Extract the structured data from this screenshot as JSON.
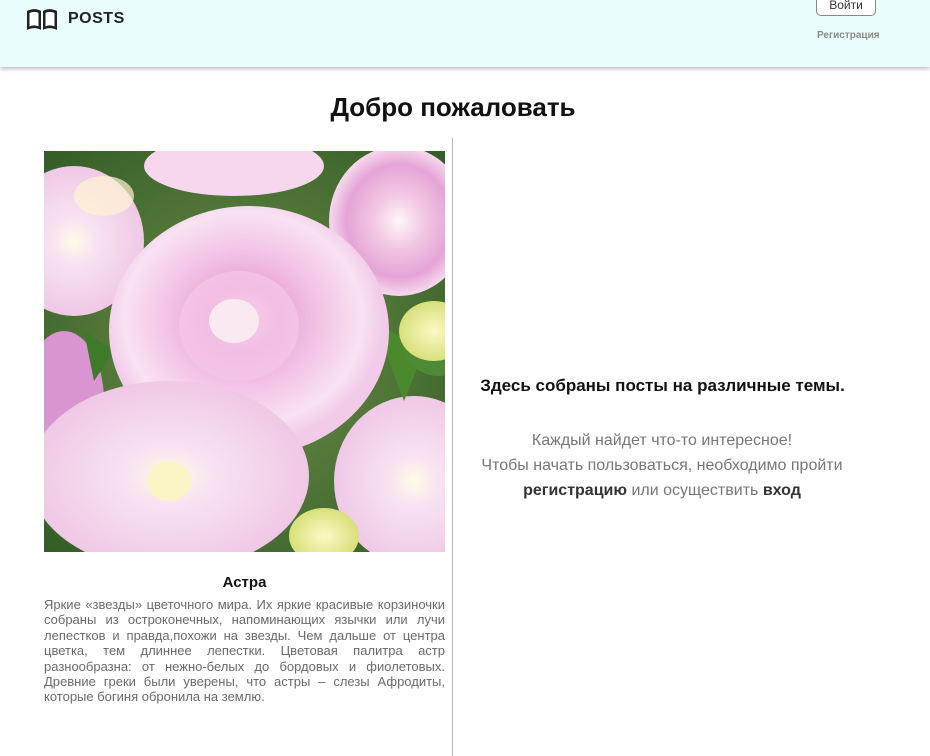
{
  "header": {
    "brand": "POSTS",
    "logo_icon": "book-icon",
    "login_label": "Войти",
    "register_label": "Регистрация",
    "background": "#eafdfd"
  },
  "main": {
    "title": "Добро пожаловать"
  },
  "card": {
    "image_subject": "pink aster flowers",
    "title": "Астра",
    "description": "Яркие «звезды» цветочного мира. Их яркие красивые корзиночки собраны из остроконечных, напоминающих язычки или лучи лепестков и правда,похожи на звезды. Чем дальше от центра цветка, тем длиннее лепестки. Цветовая палитра астр разнообразна: от нежно-белых до бордовых и фиолетовых. Древние греки были уверены, что астры – слезы Афродиты, которые богиня обронила на землю."
  },
  "intro": {
    "heading": "Здесь собраны посты на различные темы.",
    "line1": "Каждый найдет что-то интересное!",
    "line2": "Чтобы начать пользоваться, необходимо пройти",
    "register_link": "регистрацию",
    "middle": " или осуществить ",
    "login_link": "вход"
  }
}
